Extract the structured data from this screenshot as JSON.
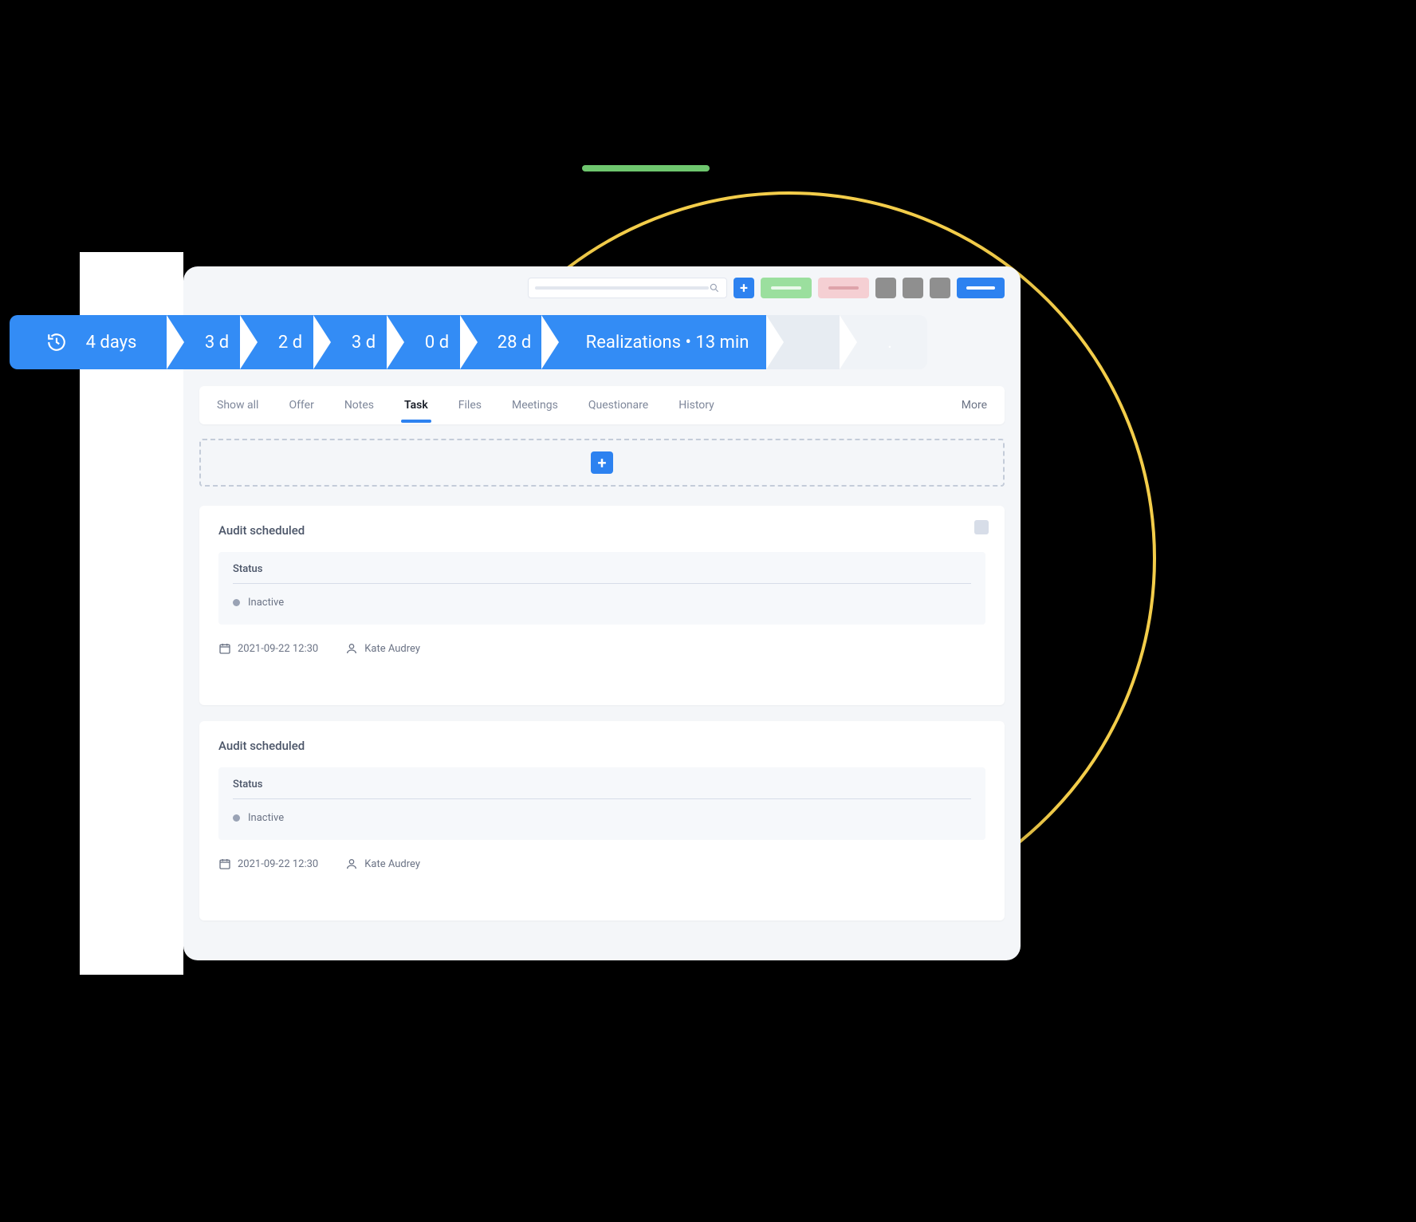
{
  "timeline": {
    "first_label": "4 days",
    "stages": [
      "3 d",
      "2 d",
      "3 d",
      "0 d",
      "28 d"
    ],
    "current": "Realizations • 13 min"
  },
  "tabs": {
    "items": [
      "Show all",
      "Offer",
      "Notes",
      "Task",
      "Files",
      "Meetings",
      "Questionare",
      "History"
    ],
    "active_index": 3,
    "more_label": "More"
  },
  "cards": [
    {
      "title": "Audit scheduled",
      "status_label": "Status",
      "status_value": "Inactive",
      "date": "2021-09-22 12:30",
      "assignee": "Kate Audrey"
    },
    {
      "title": "Audit scheduled",
      "status_label": "Status",
      "status_value": "Inactive",
      "date": "2021-09-22 12:30",
      "assignee": "Kate Audrey"
    }
  ]
}
